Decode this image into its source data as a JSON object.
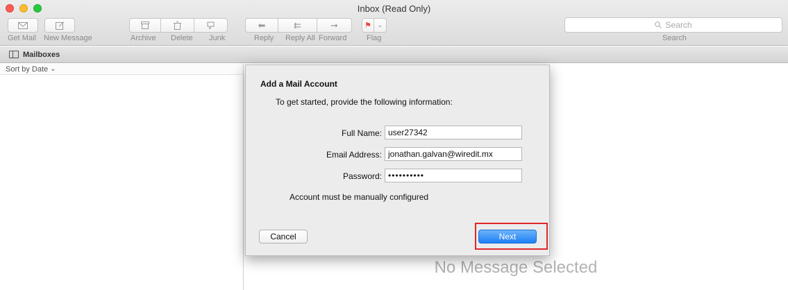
{
  "window": {
    "title": "Inbox (Read Only)"
  },
  "toolbar": {
    "get_mail": "Get Mail",
    "new_message": "New Message",
    "archive": "Archive",
    "delete": "Delete",
    "junk": "Junk",
    "reply": "Reply",
    "reply_all": "Reply All",
    "forward": "Forward",
    "flag": "Flag",
    "search_placeholder": "Search",
    "search_label": "Search"
  },
  "favorites": {
    "mailboxes": "Mailboxes"
  },
  "message_list": {
    "sort": "Sort by Date"
  },
  "viewer": {
    "empty_text": "No Message Selected"
  },
  "dialog": {
    "title": "Add a Mail Account",
    "subtitle": "To get started, provide the following information:",
    "full_name_label": "Full Name:",
    "full_name_value": "user27342",
    "email_label": "Email Address:",
    "email_value": "jonathan.galvan@wiredit.mx",
    "password_label": "Password:",
    "password_value": "••••••••••",
    "note": "Account must be manually configured",
    "cancel": "Cancel",
    "next": "Next"
  },
  "colors": {
    "accent": "#1e7ff5",
    "highlight": "#e0262a",
    "flag": "#f4413c"
  },
  "icons": [
    "envelope-icon",
    "compose-icon",
    "archive-icon",
    "trash-icon",
    "junk-icon",
    "reply-icon",
    "reply-all-icon",
    "forward-icon",
    "flag-icon",
    "search-icon",
    "mailboxes-icon"
  ]
}
